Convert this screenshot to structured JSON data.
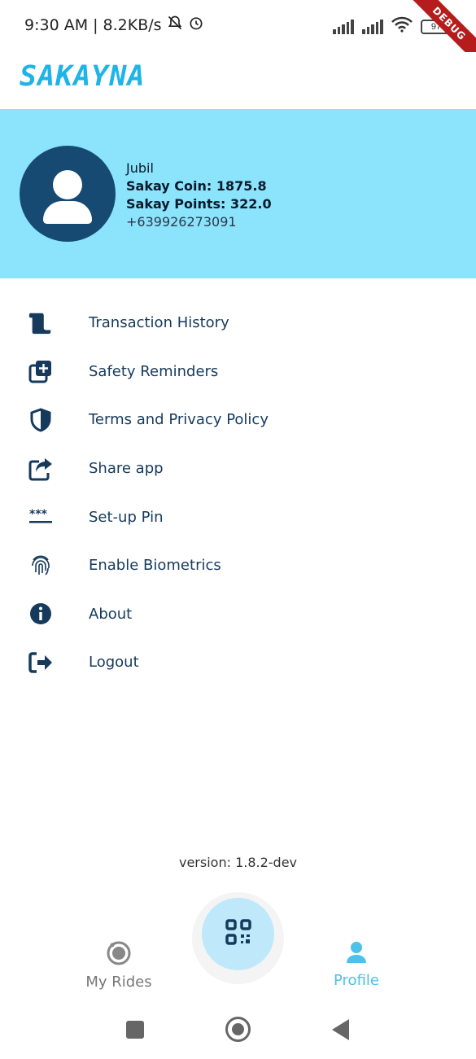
{
  "status_bar": {
    "time": "9:30 AM",
    "separator": "|",
    "speed": "8.2KB/s",
    "battery": "97",
    "debug_label": "DEBUG"
  },
  "app": {
    "logo_text": "SAKAYNA"
  },
  "profile": {
    "name": "Jubil",
    "coin": "Sakay Coin: 1875.8",
    "points": "Sakay Points: 322.0",
    "phone": "+639926273091"
  },
  "menu": {
    "items": [
      {
        "label": "Transaction History",
        "icon": "scroll-icon"
      },
      {
        "label": "Safety Reminders",
        "icon": "add-to-queue-icon"
      },
      {
        "label": "Terms and Privacy Policy",
        "icon": "shield-icon"
      },
      {
        "label": "Share app",
        "icon": "share-icon"
      },
      {
        "label": "Set-up Pin",
        "icon": "password-icon"
      },
      {
        "label": "Enable Biometrics",
        "icon": "fingerprint-icon"
      },
      {
        "label": "About",
        "icon": "info-icon"
      },
      {
        "label": "Logout",
        "icon": "logout-icon"
      }
    ]
  },
  "version": "version: 1.8.2-dev",
  "bottom_nav": {
    "rides_label": "My Rides",
    "profile_label": "Profile",
    "qr_icon": "qr-code-icon"
  },
  "colors": {
    "brand": "#1eb4e8",
    "header_bg": "#8be3fc",
    "avatar_bg": "#174a72",
    "menu_text": "#163a5c",
    "active_nav": "#4bc2ea"
  }
}
